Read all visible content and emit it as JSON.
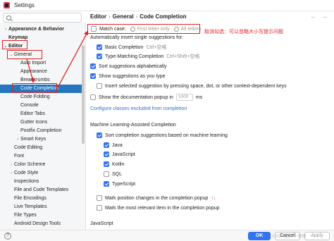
{
  "window": {
    "title": "Settings"
  },
  "search": {
    "placeholder": ""
  },
  "sidebar": {
    "items": [
      {
        "label": "Appearance & Behavior",
        "arrow": "›"
      },
      {
        "label": "Keymap",
        "arrow": ""
      },
      {
        "label": "Editor",
        "arrow": "⌄"
      },
      {
        "label": "General",
        "arrow": "⌄"
      },
      {
        "label": "Auto Import",
        "arrow": ""
      },
      {
        "label": "Appearance",
        "arrow": ""
      },
      {
        "label": "Breadcrumbs",
        "arrow": ""
      },
      {
        "label": "Code Completion",
        "arrow": ""
      },
      {
        "label": "Code Folding",
        "arrow": ""
      },
      {
        "label": "Console",
        "arrow": ""
      },
      {
        "label": "Editor Tabs",
        "arrow": ""
      },
      {
        "label": "Gutter Icons",
        "arrow": ""
      },
      {
        "label": "Postfix Completion",
        "arrow": ""
      },
      {
        "label": "Smart Keys",
        "arrow": "›"
      },
      {
        "label": "Code Editing",
        "arrow": ""
      },
      {
        "label": "Font",
        "arrow": ""
      },
      {
        "label": "Color Scheme",
        "arrow": "›"
      },
      {
        "label": "Code Style",
        "arrow": "›"
      },
      {
        "label": "Inspections",
        "arrow": ""
      },
      {
        "label": "File and Code Templates",
        "arrow": ""
      },
      {
        "label": "File Encodings",
        "arrow": ""
      },
      {
        "label": "Live Templates",
        "arrow": ""
      },
      {
        "label": "File Types",
        "arrow": ""
      },
      {
        "label": "Android Design Tools",
        "arrow": ""
      }
    ]
  },
  "breadcrumb": {
    "part1": "Editor",
    "sep": "›",
    "part2": "General",
    "part3": "Code Completion",
    "back": "←",
    "forward": "→"
  },
  "annotation": "取消勾选：可以忽略大小写提示问题",
  "content": {
    "match_case": {
      "label": "Match case:",
      "checked": false,
      "opt1": "First letter only",
      "opt2": "All letters"
    },
    "auto_insert_header": "Automatically insert single suggestions for:",
    "basic_completion": {
      "label": "Basic Completion",
      "hint": "Ctrl+空格",
      "checked": true
    },
    "type_matching": {
      "label": "Type-Matching Completion",
      "hint": "Ctrl+Shift+空格",
      "checked": true
    },
    "sort_alpha": {
      "label": "Sort suggestions alphabetically",
      "checked": true
    },
    "show_as_type": {
      "label": "Show suggestions as you type",
      "checked": true
    },
    "insert_selected": {
      "label": "Insert selected suggestion by pressing space, dot, or other context-dependent keys",
      "checked": false
    },
    "doc_popup": {
      "label": "Show the documentation popup in",
      "value": "1000",
      "unit": "ms",
      "checked": false
    },
    "configure_link": "Configure classes excluded from completion",
    "ml_header": "Machine Learning-Assisted Completion",
    "ml_sort": {
      "label": "Sort completion suggestions based on machine learning",
      "checked": true
    },
    "languages": [
      {
        "label": "Java",
        "checked": true
      },
      {
        "label": "JavaScript",
        "checked": true
      },
      {
        "label": "Kotlin",
        "checked": true
      },
      {
        "label": "SQL",
        "checked": false
      },
      {
        "label": "TypeScript",
        "checked": true
      }
    ],
    "mark_position": {
      "label": "Mark position changes in the completion popup",
      "icon": "↑↓",
      "checked": false
    },
    "mark_relevant": {
      "label": "Mark the most relevant item in the completion popup",
      "checked": false
    },
    "javascript_header": "JavaScript"
  },
  "buttons": {
    "ok": "OK",
    "cancel": "Cancel",
    "apply": "Apply"
  },
  "watermark": "CSDN @小小徐徐"
}
